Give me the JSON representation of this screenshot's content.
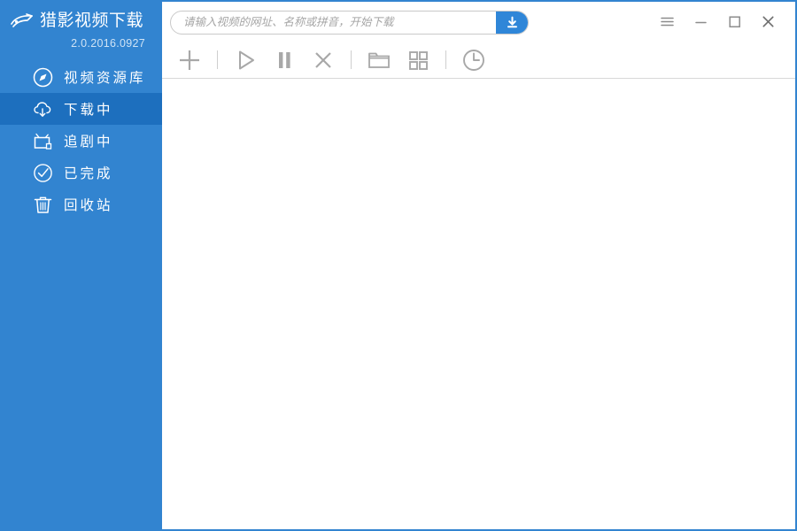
{
  "app": {
    "brand_title": "猎影视频下载",
    "version": "2.0.2016.0927",
    "logo_icon": "swoosh-logo-icon",
    "accent_color": "#3284d0",
    "sidebar_color": "#3284d0",
    "sidebar_selected_color": "#1d6fbe",
    "toolbar_icon_color": "#a8a8a8"
  },
  "sidebar": {
    "items": [
      {
        "label": "视频资源库",
        "icon": "compass-icon",
        "selected": false
      },
      {
        "label": "下载中",
        "icon": "cloud-download-icon",
        "selected": true
      },
      {
        "label": "追剧中",
        "icon": "tv-icon",
        "selected": false
      },
      {
        "label": "已完成",
        "icon": "check-circle-icon",
        "selected": false
      },
      {
        "label": "回收站",
        "icon": "trash-icon",
        "selected": false
      }
    ]
  },
  "titlebar": {
    "search": {
      "placeholder": "请输入视频的网址、名称或拼音，开始下载",
      "value": "",
      "button_icon": "download-arrow-icon",
      "button_label": "下载"
    },
    "window_controls": [
      {
        "name": "menu-button",
        "icon": "hamburger-menu-icon",
        "label": "菜单"
      },
      {
        "name": "minimize-button",
        "icon": "minimize-icon",
        "label": "最小化"
      },
      {
        "name": "maximize-button",
        "icon": "maximize-icon",
        "label": "最大化"
      },
      {
        "name": "close-button",
        "icon": "close-icon",
        "label": "关闭"
      }
    ]
  },
  "toolbar": {
    "buttons": [
      {
        "name": "add-task-button",
        "icon": "plus-icon",
        "label": "新建下载"
      },
      {
        "name": "start-button",
        "icon": "play-icon",
        "label": "开始"
      },
      {
        "name": "pause-button",
        "icon": "pause-icon",
        "label": "暂停"
      },
      {
        "name": "delete-button",
        "icon": "close-x-icon",
        "label": "删除"
      },
      {
        "name": "open-folder-button",
        "icon": "folder-icon",
        "label": "打开文件夹"
      },
      {
        "name": "grid-view-button",
        "icon": "grid-icon",
        "label": "视图"
      },
      {
        "name": "history-button",
        "icon": "clock-icon",
        "label": "历史"
      }
    ]
  },
  "main": {
    "download_list": {
      "items": [],
      "empty_text": ""
    }
  }
}
